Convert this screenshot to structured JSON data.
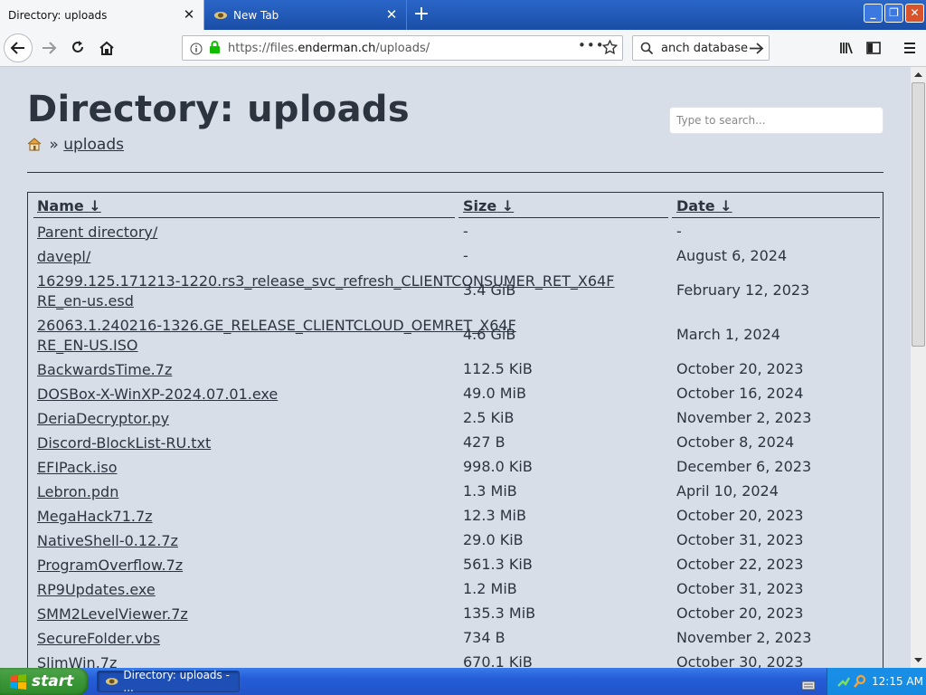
{
  "browser": {
    "tabs": [
      {
        "title": "Directory: uploads",
        "active": true
      },
      {
        "title": "New Tab",
        "active": false
      }
    ],
    "url": {
      "prefix": "https://files.",
      "domain": "enderman.ch",
      "path": "/uploads/"
    },
    "search_text": "anch database"
  },
  "page": {
    "title": "Directory: uploads",
    "breadcrumb_separator": "»",
    "breadcrumb_link": "uploads",
    "search_placeholder": "Type to search...",
    "columns": {
      "name": "Name",
      "size": "Size",
      "date": "Date",
      "sort_arrow": "↓"
    },
    "rows": [
      {
        "name": "Parent directory/",
        "size": "-",
        "date": "-"
      },
      {
        "name": "davepl/",
        "size": "-",
        "date": "August 6, 2024"
      },
      {
        "name": "16299.125.171213-1220.rs3_release_svc_refresh_CLIENTCONSUMER_RET_X64FRE_en-us.esd",
        "size": "3.4 GiB",
        "date": "February 12, 2023"
      },
      {
        "name": "26063.1.240216-1326.GE_RELEASE_CLIENTCLOUD_OEMRET_X64FRE_EN-US.ISO",
        "size": "4.6 GiB",
        "date": "March 1, 2024"
      },
      {
        "name": "BackwardsTime.7z",
        "size": "112.5 KiB",
        "date": "October 20, 2023"
      },
      {
        "name": "DOSBox-X-WinXP-2024.07.01.exe",
        "size": "49.0 MiB",
        "date": "October 16, 2024"
      },
      {
        "name": "DeriaDecryptor.py",
        "size": "2.5 KiB",
        "date": "November 2, 2023"
      },
      {
        "name": "Discord-BlockList-RU.txt",
        "size": "427 B",
        "date": "October 8, 2024"
      },
      {
        "name": "EFIPack.iso",
        "size": "998.0 KiB",
        "date": "December 6, 2023"
      },
      {
        "name": "Lebron.pdn",
        "size": "1.3 MiB",
        "date": "April 10, 2024"
      },
      {
        "name": "MegaHack71.7z",
        "size": "12.3 MiB",
        "date": "October 20, 2023"
      },
      {
        "name": "NativeShell-0.12.7z",
        "size": "29.0 KiB",
        "date": "October 31, 2023"
      },
      {
        "name": "ProgramOverflow.7z",
        "size": "561.3 KiB",
        "date": "October 22, 2023"
      },
      {
        "name": "RP9Updates.exe",
        "size": "1.2 MiB",
        "date": "October 31, 2023"
      },
      {
        "name": "SMM2LevelViewer.7z",
        "size": "135.3 MiB",
        "date": "October 20, 2023"
      },
      {
        "name": "SecureFolder.vbs",
        "size": "734 B",
        "date": "November 2, 2023"
      },
      {
        "name": "SlimWin.7z",
        "size": "670.1 KiB",
        "date": "October 30, 2023"
      }
    ]
  },
  "taskbar": {
    "start_label": "start",
    "task_item": "Directory: uploads - ...",
    "clock": "12:15 AM"
  },
  "colors": {
    "page_background": "#d8dee8",
    "text": "#2c3440",
    "titlebar_blue": "#245dd7",
    "start_green": "#3a9636"
  }
}
